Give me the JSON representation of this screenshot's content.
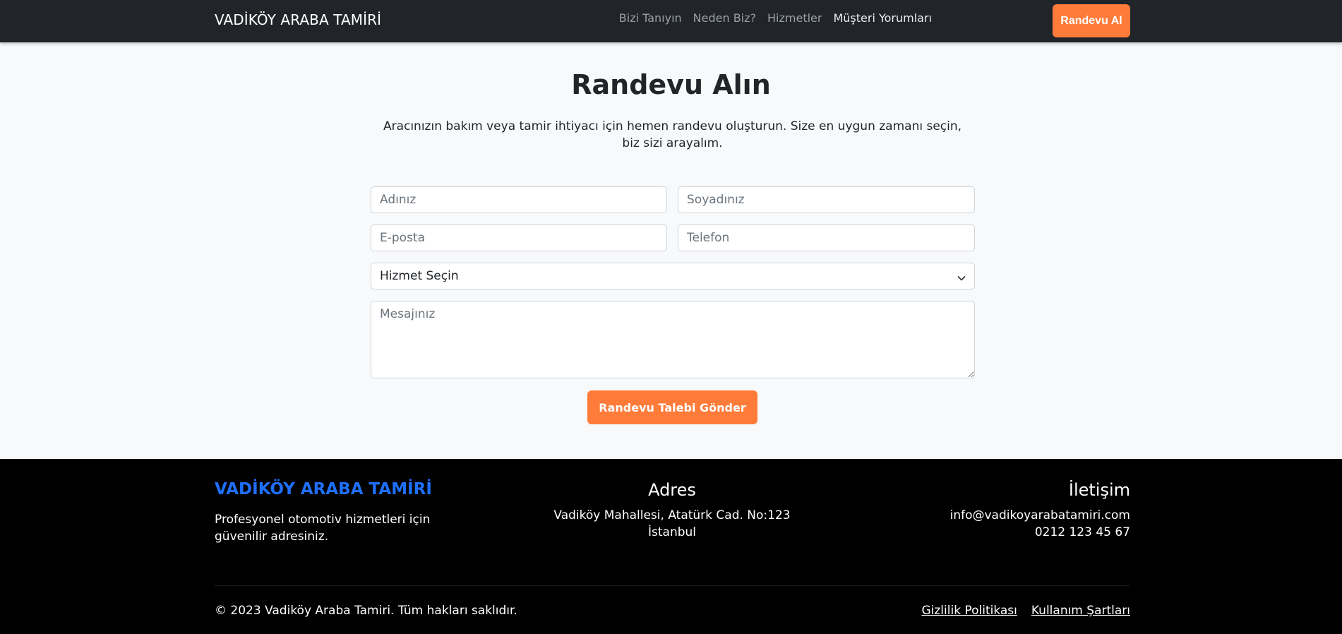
{
  "navbar": {
    "brand": "VADİKÖY ARABA TAMİRİ",
    "links": [
      {
        "label": "Bizi Tanıyın"
      },
      {
        "label": "Neden Biz?"
      },
      {
        "label": "Hizmetler"
      },
      {
        "label": "Müşteri Yorumları"
      }
    ],
    "cta": "Randevu Al"
  },
  "appointment": {
    "title": "Randevu Alın",
    "lead": "Aracınızın bakım veya tamir ihtiyacı için hemen randevu oluşturun. Size en uygun zamanı seçin, biz sizi arayalım.",
    "first_name_placeholder": "Adınız",
    "last_name_placeholder": "Soyadınız",
    "email_placeholder": "E-posta",
    "phone_placeholder": "Telefon",
    "service_selected": "Hizmet Seçin",
    "message_placeholder": "Mesajınız",
    "submit": "Randevu Talebi Gönder"
  },
  "footer": {
    "brand": "VADİKÖY ARABA TAMİRİ",
    "tagline": "Profesyonel otomotiv hizmetleri için güvenilir adresiniz.",
    "address_title": "Adres",
    "address_line1": "Vadiköy Mahallesi, Atatürk Cad. No:123",
    "address_line2": "İstanbul",
    "contact_title": "İletişim",
    "email": "info@vadikoyarabatamiri.com",
    "phone": "0212 123 45 67",
    "copyright": "© 2023 Vadiköy Araba Tamiri. Tüm hakları saklıdır.",
    "privacy": "Gizlilik Politikası",
    "terms": "Kullanım Şartları"
  },
  "colors": {
    "accent": "#ff7b39",
    "footer_brand": "#1f6fff",
    "navbar_bg": "#212529",
    "footer_bg": "#000000"
  },
  "icons": {
    "select_arrow": "chevron-down-icon"
  }
}
